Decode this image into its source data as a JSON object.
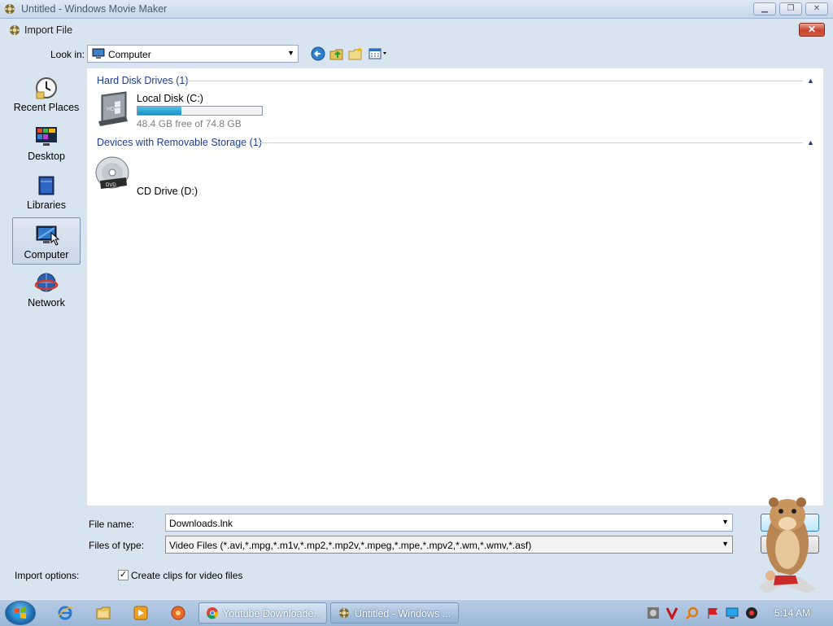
{
  "app": {
    "title": "Untitled - Windows Movie Maker"
  },
  "dialog": {
    "title": "Import File",
    "close_glyph": "✕",
    "look_in": {
      "label": "Look in:",
      "value": "Computer"
    },
    "toolbar_icons": [
      "back-icon",
      "up-folder-icon",
      "new-folder-icon",
      "views-icon"
    ],
    "places": [
      {
        "label": "Recent Places",
        "icon": "recent-places-icon"
      },
      {
        "label": "Desktop",
        "icon": "desktop-icon"
      },
      {
        "label": "Libraries",
        "icon": "libraries-icon"
      },
      {
        "label": "Computer",
        "icon": "computer-icon",
        "selected": true
      },
      {
        "label": "Network",
        "icon": "network-icon"
      }
    ],
    "groups": [
      {
        "header": "Hard Disk Drives (1)",
        "items": [
          {
            "name": "Local Disk (C:)",
            "free_text": "48.4 GB free of 74.8 GB",
            "used_fraction": 0.353,
            "icon": "hard-disk-icon"
          }
        ]
      },
      {
        "header": "Devices with Removable Storage (1)",
        "items": [
          {
            "name": "CD Drive (D:)",
            "icon": "dvd-drive-icon"
          }
        ]
      }
    ],
    "file_name": {
      "label": "File name:",
      "value": "Downloads.lnk"
    },
    "file_type": {
      "label": "Files of type:",
      "value": "Video Files (*.avi,*.mpg,*.m1v,*.mp2,*.mp2v,*.mpeg,*.mpe,*.mpv2,*.wm,*.wmv,*.asf)"
    },
    "import_options": {
      "label": "Import options:",
      "checkbox_label": "Create clips for video files",
      "checked": true
    }
  },
  "taskbar": {
    "quick_launch": [
      "internet-explorer-icon",
      "file-explorer-icon",
      "media-player-icon",
      "app-icon"
    ],
    "tasks": [
      {
        "label": "Youtube Downloade...",
        "icon": "chrome-icon"
      },
      {
        "label": "Untitled - Windows ...",
        "icon": "movie-maker-icon",
        "active": true
      }
    ],
    "tray_icons": [
      "tray-app-icon",
      "tray-v-icon",
      "tray-search-icon",
      "tray-flag-icon",
      "tray-display-icon",
      "tray-speaker-icon"
    ],
    "clock": "5:14 AM"
  },
  "colors": {
    "accent": "#1e3e8a",
    "drive_bar": "#1b8fc4",
    "window_bg": "#d9e4f1"
  }
}
